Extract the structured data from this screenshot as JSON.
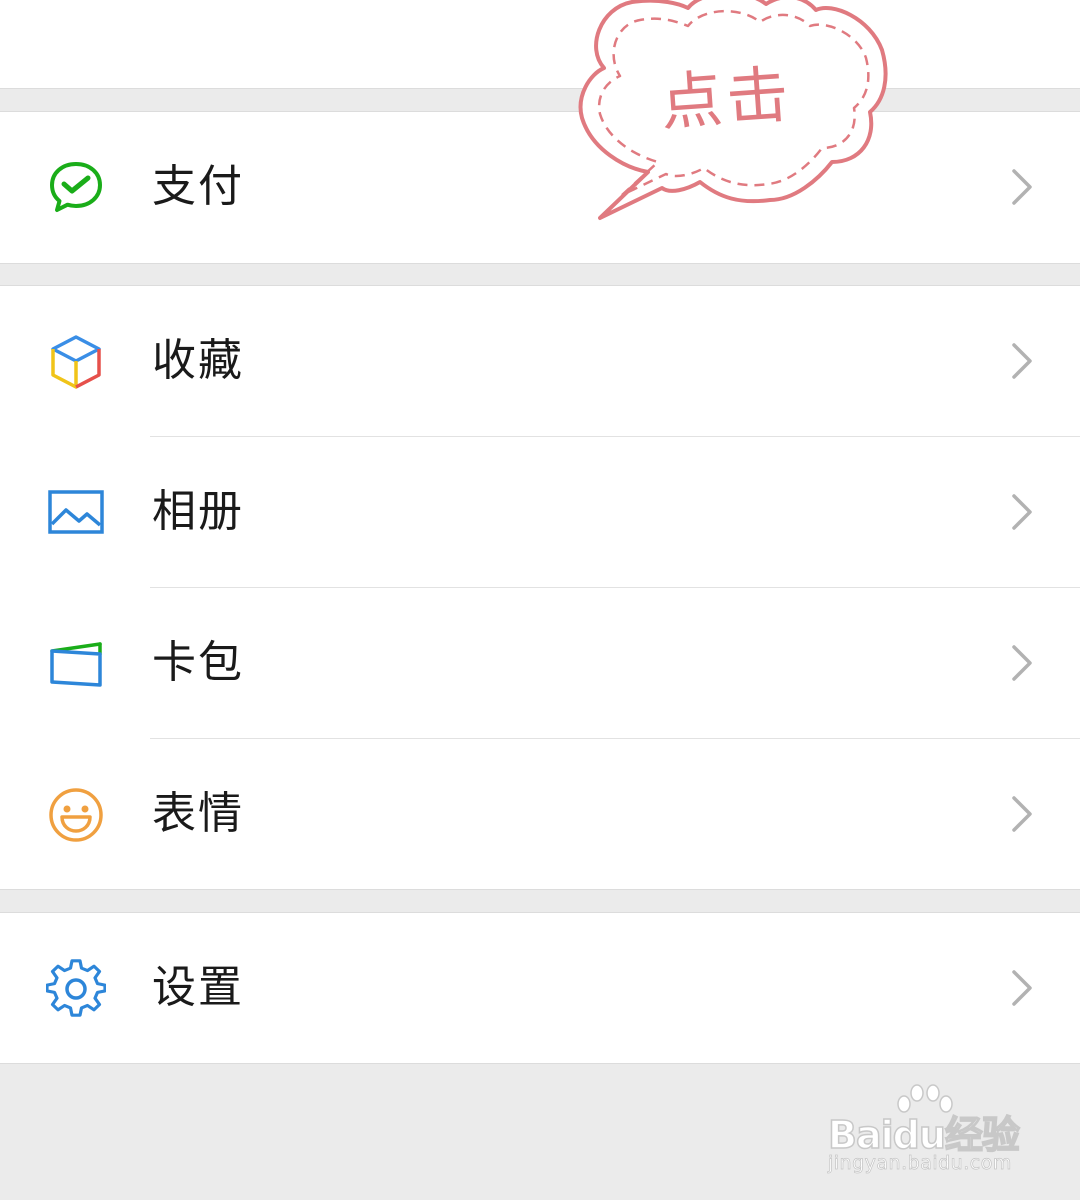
{
  "menu": {
    "payment": {
      "label": "支付",
      "icon": "wechat-pay-icon",
      "color": "#1aad19"
    },
    "favorites": {
      "label": "收藏",
      "icon": "cube-icon",
      "colors": [
        "#3a8ee6",
        "#e6504b",
        "#f0c419"
      ]
    },
    "album": {
      "label": "相册",
      "icon": "image-icon",
      "color": "#2d86d9"
    },
    "cards": {
      "label": "卡包",
      "icon": "wallet-icon",
      "colors": [
        "#2d86d9",
        "#1aad19"
      ]
    },
    "stickers": {
      "label": "表情",
      "icon": "smiley-icon",
      "color": "#f0a040"
    },
    "settings": {
      "label": "设置",
      "icon": "gear-icon",
      "color": "#2d86d9"
    }
  },
  "annotation": {
    "text": "点击",
    "color": "#e07a80"
  },
  "watermark": {
    "logo": "Baidu经验",
    "url": "jingyan.baidu.com"
  }
}
